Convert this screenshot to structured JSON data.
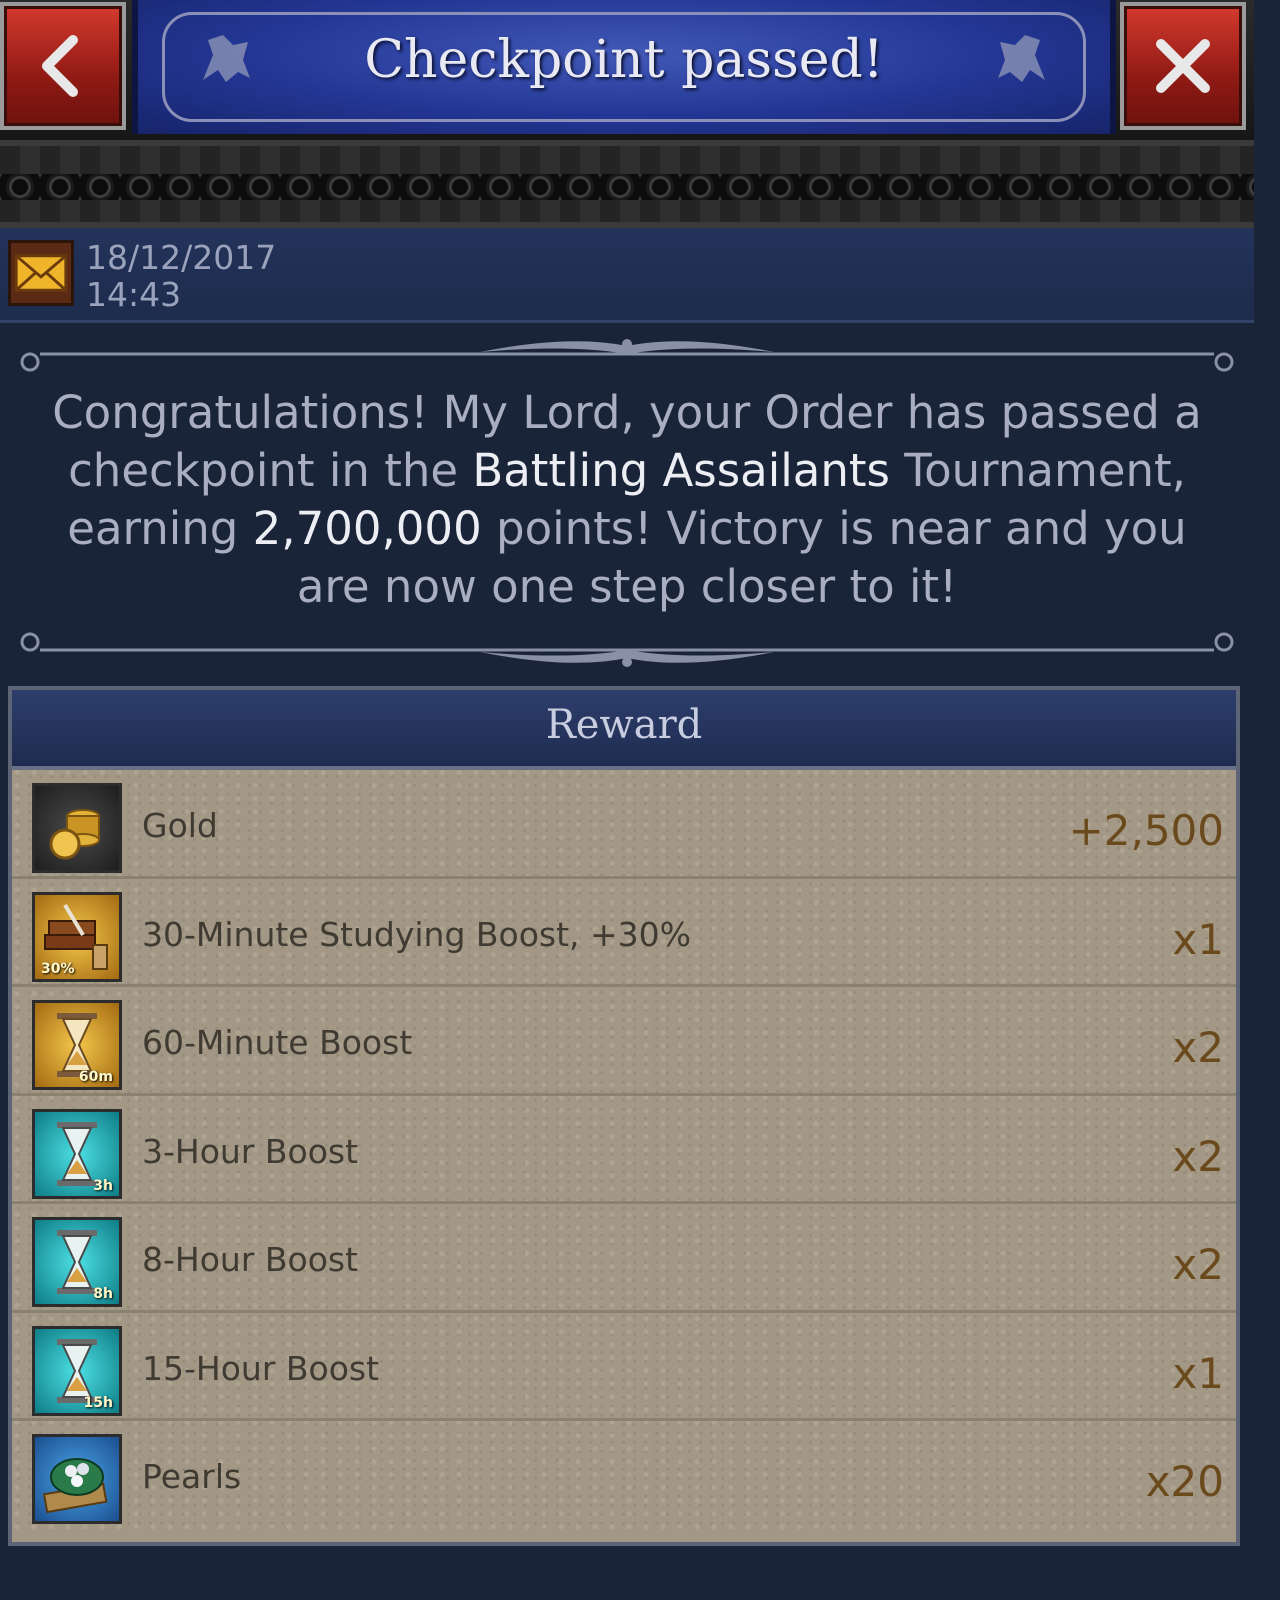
{
  "header": {
    "title": "Checkpoint passed!"
  },
  "meta": {
    "date": "18/12/2017",
    "time": "14:43"
  },
  "message": {
    "part1": "Congratulations! My Lord, your Order has passed a checkpoint in the ",
    "tournament": "Battling Assailants",
    "part2": " Tournament, earning ",
    "points": "2,700,000",
    "part3": " points! Victory is near and you are now one step closer to it!"
  },
  "reward": {
    "title": "Reward",
    "items": [
      {
        "name": "Gold",
        "value": "+2,500",
        "icon": "gold-coins-icon",
        "badge": ""
      },
      {
        "name": "30-Minute Studying Boost, +30%",
        "value": "x1",
        "icon": "books-boost-icon",
        "badge": "30%"
      },
      {
        "name": "60-Minute Boost",
        "value": "x2",
        "icon": "hourglass-icon",
        "badge": "60m"
      },
      {
        "name": "3-Hour Boost",
        "value": "x2",
        "icon": "hourglass-icon",
        "badge": "3h"
      },
      {
        "name": "8-Hour Boost",
        "value": "x2",
        "icon": "hourglass-icon",
        "badge": "8h"
      },
      {
        "name": "15-Hour Boost",
        "value": "x1",
        "icon": "hourglass-icon",
        "badge": "15h"
      },
      {
        "name": "Pearls",
        "value": "x20",
        "icon": "pearls-bag-icon",
        "badge": ""
      }
    ]
  },
  "colors": {
    "header_blue": "#233694",
    "button_red": "#b0241c",
    "parchment": "#a39885",
    "reward_value": "#6a4a1c"
  }
}
